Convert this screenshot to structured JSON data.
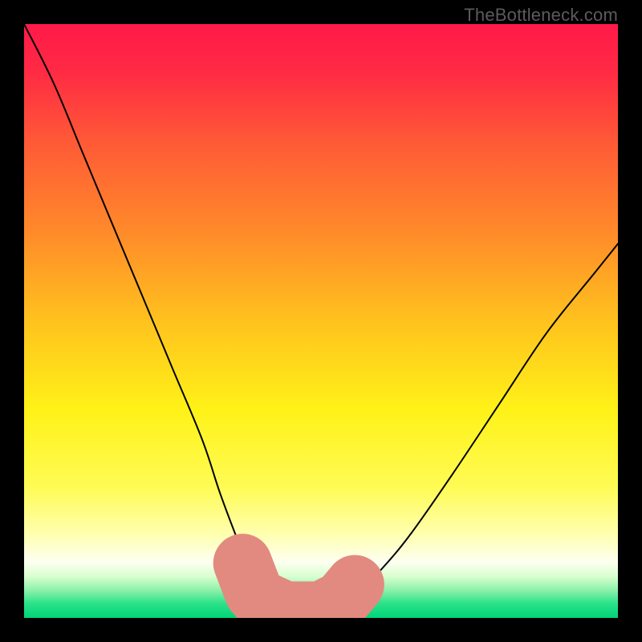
{
  "watermark": {
    "text": "TheBottleneck.com"
  },
  "chart_data": {
    "type": "line",
    "title": "",
    "xlabel": "",
    "ylabel": "",
    "xlim": [
      0,
      100
    ],
    "ylim": [
      0,
      100
    ],
    "grid": false,
    "legend": false,
    "background": {
      "type": "vertical-gradient",
      "stops": [
        {
          "offset": 0.0,
          "color": "#ff1a49"
        },
        {
          "offset": 0.08,
          "color": "#ff2a44"
        },
        {
          "offset": 0.2,
          "color": "#ff5a36"
        },
        {
          "offset": 0.35,
          "color": "#ff8a2a"
        },
        {
          "offset": 0.5,
          "color": "#ffc21e"
        },
        {
          "offset": 0.65,
          "color": "#fff218"
        },
        {
          "offset": 0.78,
          "color": "#fffb55"
        },
        {
          "offset": 0.86,
          "color": "#ffffb0"
        },
        {
          "offset": 0.905,
          "color": "#fdfff0"
        },
        {
          "offset": 0.93,
          "color": "#d9ffd0"
        },
        {
          "offset": 0.955,
          "color": "#86f0a8"
        },
        {
          "offset": 0.975,
          "color": "#2de28a"
        },
        {
          "offset": 1.0,
          "color": "#00d477"
        }
      ]
    },
    "series": [
      {
        "name": "bottleneck-curve",
        "color": "#000000",
        "stroke_width": 2,
        "x": [
          0,
          5,
          10,
          15,
          20,
          25,
          30,
          33,
          36,
          38,
          40,
          42,
          45,
          48,
          52,
          56,
          60,
          65,
          72,
          80,
          88,
          96,
          100
        ],
        "y": [
          100,
          90,
          78,
          66,
          54,
          42,
          30,
          21,
          13,
          8,
          4,
          2,
          1,
          1,
          2,
          4,
          8,
          14,
          24,
          36,
          48,
          58,
          63
        ]
      }
    ],
    "marker_band": {
      "name": "optimal-range-marker",
      "color": "#e38a80",
      "description": "Rounded pink band marking the curve minimum",
      "points": [
        {
          "x": 36.5,
          "y": 10
        },
        {
          "x": 39.0,
          "y": 3.5
        },
        {
          "x": 44.0,
          "y": 1.2
        },
        {
          "x": 50.0,
          "y": 1.2
        },
        {
          "x": 53.5,
          "y": 3.0
        },
        {
          "x": 56.0,
          "y": 6.0
        }
      ],
      "thickness": 4.5
    }
  }
}
